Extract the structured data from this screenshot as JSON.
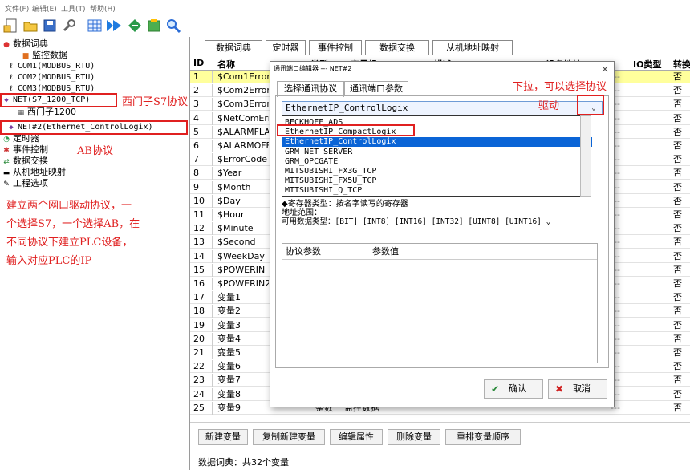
{
  "menu": [
    "文件(F)",
    "编辑(E)",
    "工具(T)",
    "帮助(H)"
  ],
  "toolbar_icons": [
    "new-file-icon",
    "open-folder-icon",
    "save-icon",
    "wrench-icon",
    "grid-icon",
    "run-icon",
    "network-icon",
    "report-icon",
    "search-icon"
  ],
  "tree": [
    {
      "label": "数据词典",
      "icon": "database-icon"
    },
    {
      "label": "监控数据",
      "icon": "monitor-data-icon"
    },
    {
      "label": "COM1(MODBUS_RTU)",
      "icon": "com-port-icon"
    },
    {
      "label": "COM2(MODBUS_RTU)",
      "icon": "com-port-icon"
    },
    {
      "label": "COM3(MODBUS_RTU)",
      "icon": "com-port-icon"
    },
    {
      "label": "NET(S7_1200_TCP)",
      "icon": "network-port-icon"
    },
    {
      "label": "西门子1200",
      "icon": "plc-device-icon"
    },
    {
      "label": "NET#2(Ethernet_ControlLogix)",
      "icon": "network-port-icon"
    },
    {
      "label": "定时器",
      "icon": "timer-icon"
    },
    {
      "label": "事件控制",
      "icon": "event-icon"
    },
    {
      "label": "数据交换",
      "icon": "exchange-icon"
    },
    {
      "label": "从机地址映射",
      "icon": "address-map-icon"
    },
    {
      "label": "工程选项",
      "icon": "project-options-icon"
    }
  ],
  "annotations": {
    "siemens": "西门子S7协议",
    "ab": "AB协议",
    "dropdown_hint_1": "下拉，可以选择协议",
    "dropdown_hint_2": "驱动",
    "instructions": [
      "建立两个网口驱动协议，一",
      "个选择S7，一个选择AB，在",
      "不同协议下建立PLC设备，",
      "输入对应PLC的IP"
    ]
  },
  "tabs": [
    "数据词典",
    "定时器",
    "事件控制",
    "数据交换",
    "从机地址映射"
  ],
  "columns": {
    "id": "ID",
    "name": "名称",
    "type": "类型",
    "group": "变量组",
    "desc": "描述",
    "addr": "IO设备地址",
    "iotype": "IO类型",
    "conv": "转换"
  },
  "rows": [
    {
      "id": "1",
      "name": "$Com1Error",
      "type": "",
      "group": "",
      "addr": "---",
      "yn": "否"
    },
    {
      "id": "2",
      "name": "$Com2Error",
      "type": "",
      "group": "",
      "addr": "---",
      "yn": "否"
    },
    {
      "id": "3",
      "name": "$Com3Error",
      "type": "",
      "group": "",
      "addr": "---",
      "yn": "否"
    },
    {
      "id": "4",
      "name": "$NetComError",
      "type": "",
      "group": "",
      "addr": "---",
      "yn": "否"
    },
    {
      "id": "5",
      "name": "$ALARMFLAG",
      "type": "",
      "group": "",
      "addr": "---",
      "yn": "否"
    },
    {
      "id": "6",
      "name": "$ALARMOFF",
      "type": "",
      "group": "",
      "addr": "---",
      "yn": "否"
    },
    {
      "id": "7",
      "name": "$ErrorCode",
      "type": "",
      "group": "",
      "addr": "---",
      "yn": "否"
    },
    {
      "id": "8",
      "name": "$Year",
      "type": "",
      "group": "",
      "addr": "---",
      "yn": "否"
    },
    {
      "id": "9",
      "name": "$Month",
      "type": "",
      "group": "",
      "addr": "---",
      "yn": "否"
    },
    {
      "id": "10",
      "name": "$Day",
      "type": "",
      "group": "",
      "addr": "---",
      "yn": "否"
    },
    {
      "id": "11",
      "name": "$Hour",
      "type": "",
      "group": "",
      "addr": "---",
      "yn": "否"
    },
    {
      "id": "12",
      "name": "$Minute",
      "type": "",
      "group": "",
      "addr": "---",
      "yn": "否"
    },
    {
      "id": "13",
      "name": "$Second",
      "type": "",
      "group": "",
      "addr": "---",
      "yn": "否"
    },
    {
      "id": "14",
      "name": "$WeekDay",
      "type": "",
      "group": "",
      "addr": "---",
      "yn": "否"
    },
    {
      "id": "15",
      "name": "$POWERIN",
      "type": "",
      "group": "",
      "addr": "---",
      "yn": "否"
    },
    {
      "id": "16",
      "name": "$POWERIN2",
      "type": "",
      "group": "",
      "addr": "---",
      "yn": "否"
    },
    {
      "id": "17",
      "name": "变量1",
      "type": "",
      "group": "",
      "addr": "---",
      "yn": "否"
    },
    {
      "id": "18",
      "name": "变量2",
      "type": "",
      "group": "",
      "addr": "---",
      "yn": "否"
    },
    {
      "id": "19",
      "name": "变量3",
      "type": "",
      "group": "",
      "addr": "---",
      "yn": "否"
    },
    {
      "id": "20",
      "name": "变量4",
      "type": "",
      "group": "",
      "addr": "---",
      "yn": "否"
    },
    {
      "id": "21",
      "name": "变量5",
      "type": "",
      "group": "",
      "addr": "---",
      "yn": "否"
    },
    {
      "id": "22",
      "name": "变量6",
      "type": "",
      "group": "",
      "addr": "---",
      "yn": "否"
    },
    {
      "id": "23",
      "name": "变量7",
      "type": "",
      "group": "",
      "addr": "---",
      "yn": "否"
    },
    {
      "id": "24",
      "name": "变量8",
      "type": "",
      "group": "",
      "addr": "---",
      "yn": "否"
    },
    {
      "id": "25",
      "name": "变量9",
      "type": "整数",
      "group": "监控数据",
      "addr": "---",
      "yn": "否"
    }
  ],
  "buttons": [
    "新建变量",
    "复制新建变量",
    "编辑属性",
    "删除变量",
    "重排变量顺序"
  ],
  "status": "数据词典：共32个变量",
  "dialog": {
    "title": "通讯端口编辑器 --- NET#2",
    "close": "×",
    "tabs": [
      "选择通讯协议",
      "通讯端口参数"
    ],
    "selected": "EthernetIP_ControlLogix",
    "combo_arrow": "⌄",
    "options": [
      "BECKHOFF_ADS",
      "EthernetIP_CompactLogix",
      "EthernetIP_ControlLogix",
      "GRM_NET_SERVER",
      "GRM_OPCGATE",
      "MITSUBISHI_FX3G_TCP",
      "MITSUBISHI_FX5U_TCP",
      "MITSUBISHI_Q_TCP"
    ],
    "info": [
      "◆寄存器类型：按名字读写的寄存器",
      "地址范围：",
      "可用数据类型：[BIT] [INT8] [INT16] [INT32] [UINT8] [UINT16] ⌄"
    ],
    "param_col": "协议参数",
    "value_col": "参数值",
    "ok": "确认",
    "cancel": "取消"
  },
  "colors": {
    "accent_red": "#e02020",
    "selected_blue": "#0a64d6",
    "row_highlight": "#ffff9c"
  }
}
